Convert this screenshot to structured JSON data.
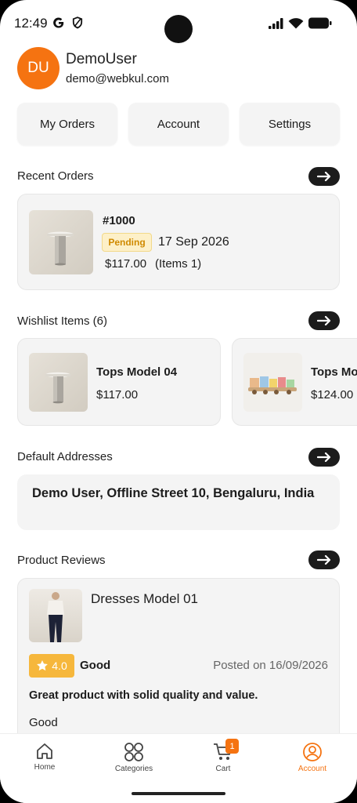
{
  "status_bar": {
    "time": "12:49"
  },
  "profile": {
    "initials": "DU",
    "name": "DemoUser",
    "email": "demo@webkul.com"
  },
  "quick_actions": {
    "orders": "My Orders",
    "account": "Account",
    "settings": "Settings"
  },
  "recent_orders": {
    "title": "Recent Orders",
    "order": {
      "id": "#1000",
      "status": "Pending",
      "date": "17 Sep 2026",
      "total": "$117.00",
      "items": "(Items 1)"
    }
  },
  "wishlist": {
    "title": "Wishlist Items (6)",
    "items": [
      {
        "name": "Tops Model 04",
        "price": "$117.00"
      },
      {
        "name": "Tops Mo",
        "price": "$124.00"
      }
    ]
  },
  "addresses": {
    "title": "Default Addresses",
    "default": "Demo User, Offline Street 10, Bengaluru, India"
  },
  "reviews": {
    "title": "Product Reviews",
    "review": {
      "product": "Dresses Model 01",
      "rating": "4.0",
      "rating_label": "Good",
      "posted": "Posted on 16/09/2026",
      "headline": "Great product with solid quality and value.",
      "body": "Good"
    }
  },
  "bottom_nav": {
    "home": "Home",
    "categories": "Categories",
    "cart": "Cart",
    "cart_count": "1",
    "account": "Account"
  },
  "colors": {
    "accent": "#f57311",
    "pending_bg": "#fdf0c8",
    "pending_text": "#d08a00",
    "rating_bg": "#f6b73c"
  }
}
